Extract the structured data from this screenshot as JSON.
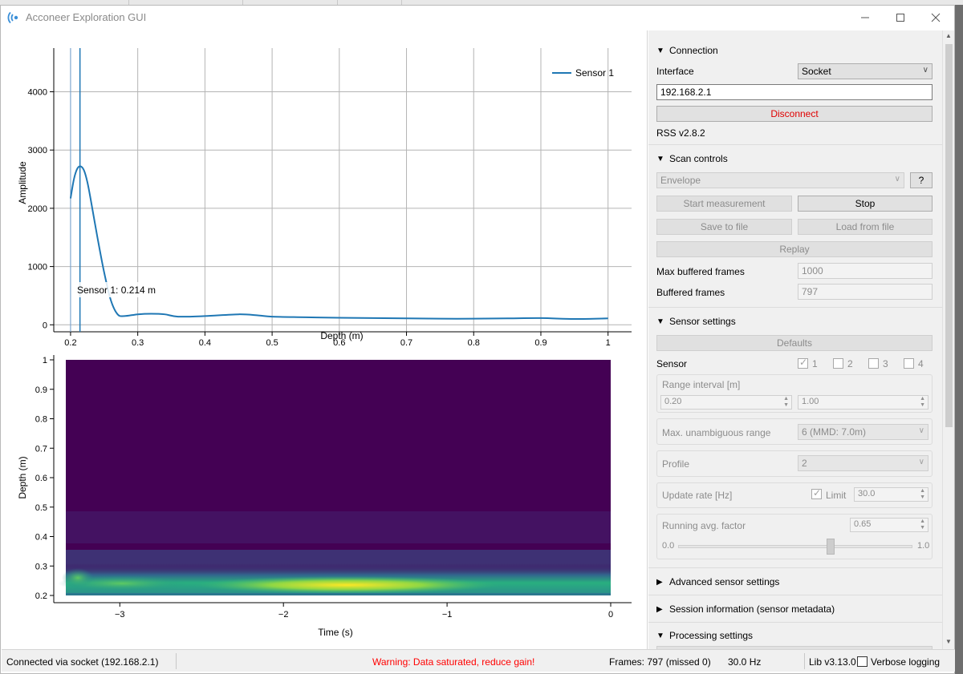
{
  "window": {
    "title": "Acconeer Exploration GUI"
  },
  "connection": {
    "header": "Connection",
    "interface_label": "Interface",
    "interface_value": "Socket",
    "ip": "192.168.2.1",
    "disconnect_label": "Disconnect",
    "rss_version": "RSS v2.8.2"
  },
  "scan_controls": {
    "header": "Scan controls",
    "service": "Envelope",
    "help_label": "?",
    "start_label": "Start measurement",
    "stop_label": "Stop",
    "save_label": "Save to file",
    "load_label": "Load from file",
    "replay_label": "Replay",
    "max_buffered_label": "Max buffered frames",
    "max_buffered_value": "1000",
    "buffered_label": "Buffered frames",
    "buffered_value": "797"
  },
  "sensor_settings": {
    "header": "Sensor settings",
    "defaults_label": "Defaults",
    "sensor_label": "Sensor",
    "sensors": [
      {
        "label": "1",
        "checked": true
      },
      {
        "label": "2",
        "checked": false
      },
      {
        "label": "3",
        "checked": false
      },
      {
        "label": "4",
        "checked": false
      }
    ],
    "range_label": "Range interval [m]",
    "range_start": "0.20",
    "range_end": "1.00",
    "mur_label": "Max. unambiguous range",
    "mur_value": "6 (MMD: 7.0m)",
    "profile_label": "Profile",
    "profile_value": "2",
    "update_rate_label": "Update rate [Hz]",
    "limit_label": "Limit",
    "limit_checked": true,
    "update_rate_value": "30.0",
    "running_avg_label": "Running avg. factor",
    "running_avg_value": "0.65",
    "slider_min": "0.0",
    "slider_max": "1.0",
    "slider_fraction": 0.65
  },
  "collapsed_sections": {
    "advanced": "Advanced sensor settings",
    "session": "Session information (sensor metadata)",
    "processing": "Processing settings"
  },
  "status_bar": {
    "connection": "Connected via socket (192.168.2.1)",
    "warning": "Warning: Data saturated, reduce gain!",
    "frames": "Frames: 797 (missed 0)",
    "rate": "30.0 Hz",
    "lib": "Lib v3.13.0",
    "verbose_label": "Verbose logging"
  },
  "colors": {
    "accent_line": "#1f77b4",
    "warning": "#ff0000",
    "disconnect": "#e00000"
  },
  "chart_data": [
    {
      "type": "line",
      "xlabel": "Depth (m)",
      "ylabel": "Amplitude",
      "xlim": [
        0.175,
        1.035
      ],
      "ylim": [
        -120,
        4750
      ],
      "xticks": [
        "0.2",
        "0.3",
        "0.4",
        "0.5",
        "0.6",
        "0.7",
        "0.8",
        "0.9",
        "1"
      ],
      "yticks": [
        "0",
        "1000",
        "2000",
        "3000",
        "4000"
      ],
      "grid": true,
      "legend": "top-right",
      "series": [
        {
          "name": "Sensor 1",
          "x": [
            0.2,
            0.205,
            0.21,
            0.215,
            0.22,
            0.225,
            0.23,
            0.24,
            0.25,
            0.26,
            0.27,
            0.28,
            0.3,
            0.32,
            0.34,
            0.36,
            0.4,
            0.45,
            0.48,
            0.5,
            0.55,
            0.6,
            0.65,
            0.7,
            0.75,
            0.8,
            0.85,
            0.9,
            0.95,
            1.0
          ],
          "y": [
            2170,
            2500,
            2680,
            2720,
            2650,
            2450,
            2150,
            1500,
            900,
            420,
            180,
            150,
            180,
            190,
            180,
            140,
            150,
            180,
            160,
            140,
            130,
            120,
            115,
            110,
            105,
            105,
            110,
            115,
            100,
            110
          ]
        }
      ],
      "cursor": {
        "x": 0.214,
        "label": "Sensor 1: 0.214 m"
      },
      "secondary_vline_x": 0.2
    },
    {
      "type": "heatmap",
      "xlabel": "Time (s)",
      "ylabel": "Depth (m)",
      "xlim": [
        -3.33,
        0
      ],
      "ylim": [
        0.2,
        1.0
      ],
      "xticks": [
        "-3",
        "-2",
        "-1",
        "0"
      ],
      "yticks": [
        "0.2",
        "0.3",
        "0.4",
        "0.5",
        "0.6",
        "0.7",
        "0.8",
        "0.9",
        "1"
      ],
      "colormap": "viridis"
    }
  ]
}
